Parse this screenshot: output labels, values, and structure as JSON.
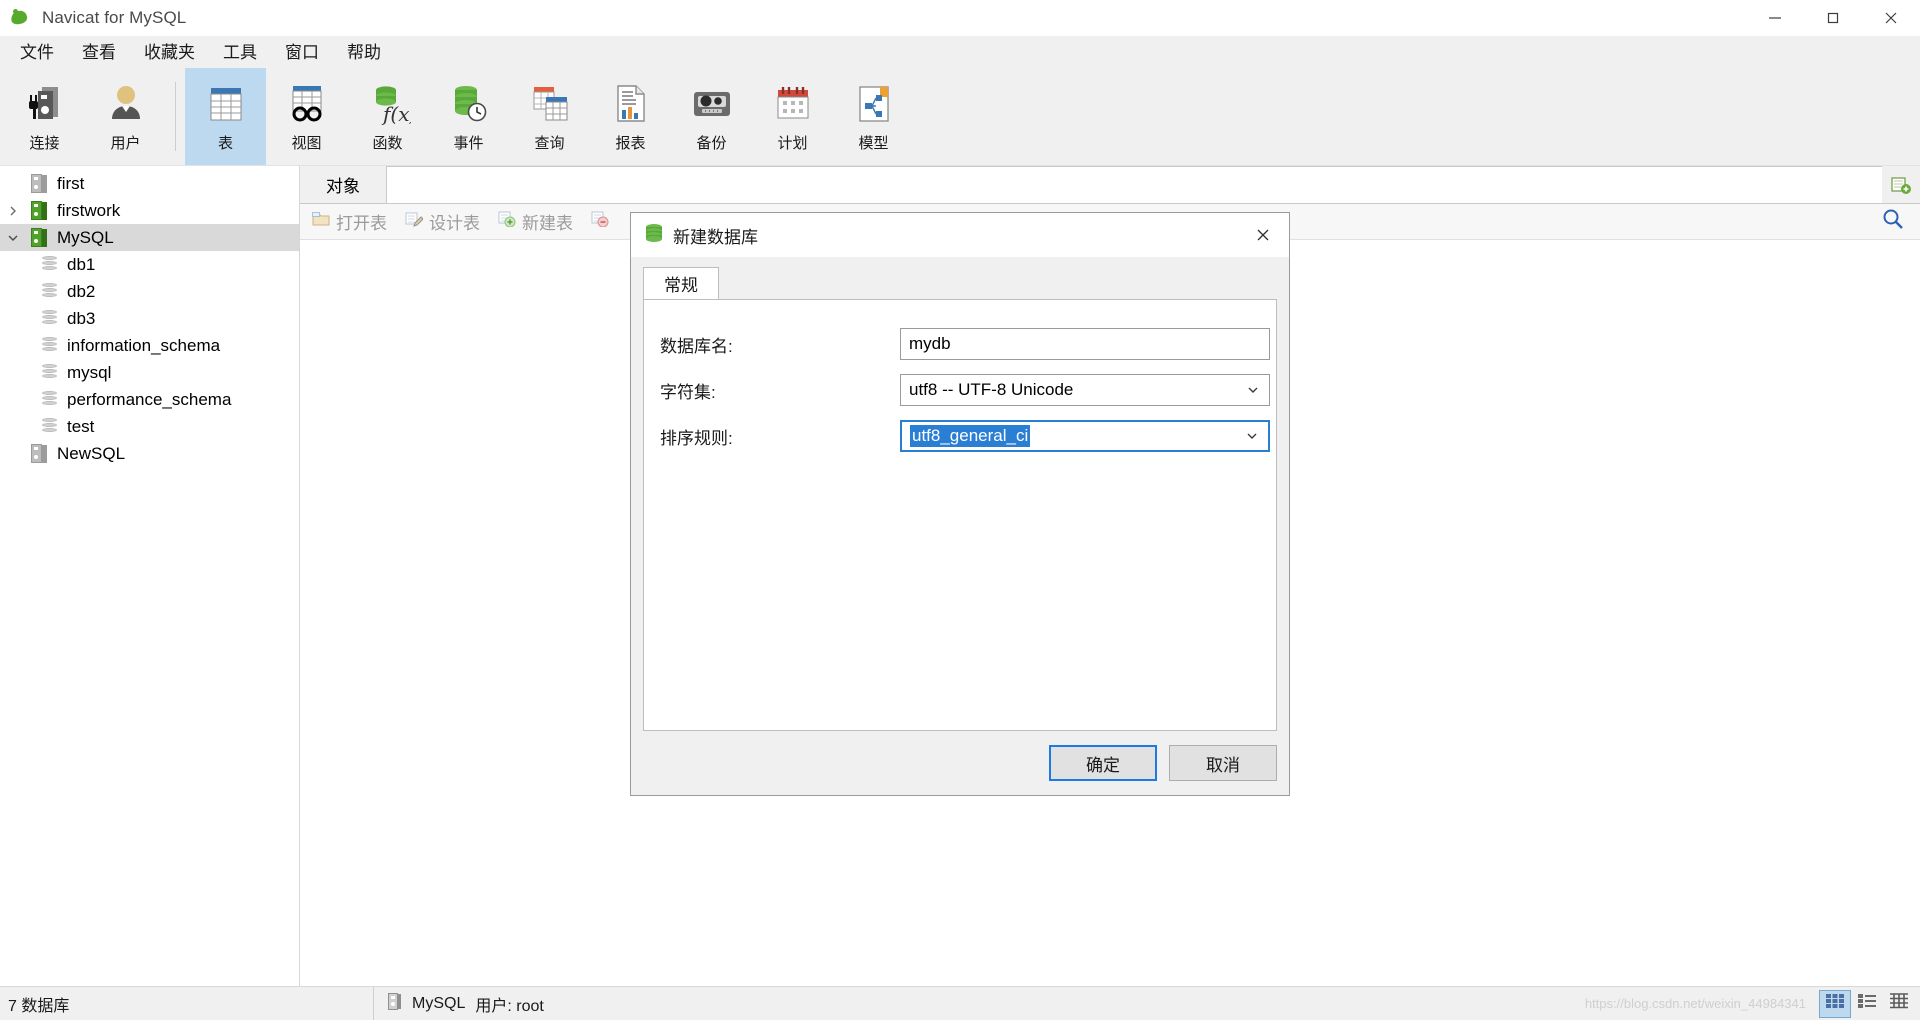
{
  "window": {
    "app_title": "Navicat for MySQL",
    "app_icon": "navicat-leaf-icon",
    "minimize": "minimize-icon",
    "maximize": "maximize-icon",
    "close": "close-icon"
  },
  "menubar": {
    "items": [
      {
        "label": "文件",
        "name": "menu-file"
      },
      {
        "label": "查看",
        "name": "menu-view"
      },
      {
        "label": "收藏夹",
        "name": "menu-favorites"
      },
      {
        "label": "工具",
        "name": "menu-tools"
      },
      {
        "label": "窗口",
        "name": "menu-window"
      },
      {
        "label": "帮助",
        "name": "menu-help"
      }
    ]
  },
  "toolbar": {
    "items": [
      {
        "label": "连接",
        "icon": "connection-icon",
        "active": false
      },
      {
        "label": "用户",
        "icon": "user-icon",
        "active": false
      },
      {
        "label": "表",
        "icon": "table-icon",
        "active": true
      },
      {
        "label": "视图",
        "icon": "view-glasses-icon",
        "active": false
      },
      {
        "label": "函数",
        "icon": "function-icon",
        "active": false
      },
      {
        "label": "事件",
        "icon": "event-clock-icon",
        "active": false
      },
      {
        "label": "查询",
        "icon": "query-icon",
        "active": false
      },
      {
        "label": "报表",
        "icon": "report-icon",
        "active": false
      },
      {
        "label": "备份",
        "icon": "backup-tape-icon",
        "active": false
      },
      {
        "label": "计划",
        "icon": "schedule-calendar-icon",
        "active": false
      },
      {
        "label": "模型",
        "icon": "model-icon",
        "active": false
      }
    ]
  },
  "sidebar": {
    "tree": [
      {
        "label": "first",
        "level": 1,
        "icon": "server-icon-gray",
        "expander": "none",
        "selected": false
      },
      {
        "label": "firstwork",
        "level": 1,
        "icon": "server-icon-green",
        "expander": "collapsed",
        "selected": false
      },
      {
        "label": "MySQL",
        "level": 1,
        "icon": "server-icon-green",
        "expander": "expanded",
        "selected": true
      },
      {
        "label": "db1",
        "level": 2,
        "icon": "database-icon",
        "expander": "none",
        "selected": false
      },
      {
        "label": "db2",
        "level": 2,
        "icon": "database-icon",
        "expander": "none",
        "selected": false
      },
      {
        "label": "db3",
        "level": 2,
        "icon": "database-icon",
        "expander": "none",
        "selected": false
      },
      {
        "label": "information_schema",
        "level": 2,
        "icon": "database-icon",
        "expander": "none",
        "selected": false
      },
      {
        "label": "mysql",
        "level": 2,
        "icon": "database-icon",
        "expander": "none",
        "selected": false
      },
      {
        "label": "performance_schema",
        "level": 2,
        "icon": "database-icon",
        "expander": "none",
        "selected": false
      },
      {
        "label": "test",
        "level": 2,
        "icon": "database-icon",
        "expander": "none",
        "selected": false
      },
      {
        "label": "NewSQL",
        "level": 1,
        "icon": "server-icon-gray",
        "expander": "none",
        "selected": false
      }
    ]
  },
  "content": {
    "tab_label": "对象",
    "add_tab_icon": "add-tab-icon",
    "search_icon": "search-icon",
    "object_buttons": [
      {
        "label": "打开表",
        "icon": "open-table-icon"
      },
      {
        "label": "设计表",
        "icon": "design-table-icon"
      },
      {
        "label": "新建表",
        "icon": "new-table-icon"
      },
      {
        "label": "",
        "icon": "delete-table-icon"
      }
    ]
  },
  "dialog": {
    "title": "新建数据库",
    "title_icon": "database-icon",
    "close_icon": "close-icon",
    "tabs": [
      {
        "label": "常规",
        "active": true
      }
    ],
    "fields": [
      {
        "name": "database-name",
        "label": "数据库名:",
        "type": "text",
        "value": "mydb",
        "highlighted": false
      },
      {
        "name": "charset",
        "label": "字符集:",
        "type": "select",
        "value": "utf8 -- UTF-8 Unicode",
        "highlighted": false
      },
      {
        "name": "collation",
        "label": "排序规则:",
        "type": "select",
        "value": "utf8_general_ci",
        "highlighted": true
      }
    ],
    "buttons": [
      {
        "label": "确定",
        "name": "ok-button",
        "primary": true
      },
      {
        "label": "取消",
        "name": "cancel-button",
        "primary": false
      }
    ]
  },
  "statusbar": {
    "left_text": "7 数据库",
    "connection_icon": "server-icon-gray",
    "connection_name": "MySQL",
    "user_text": "用户: root",
    "watermark": "https://blog.csdn.net/weixin_44984341",
    "view_buttons": [
      {
        "name": "grid-view-button",
        "icon": "grid-view-icon",
        "selected": true
      },
      {
        "name": "detail-view-button",
        "icon": "detail-view-icon",
        "selected": false
      },
      {
        "name": "list-view-button",
        "icon": "list-view-icon",
        "selected": false
      }
    ]
  },
  "colors": {
    "accent": "#2a7fd4",
    "toolbar_active": "#bcd9f0",
    "tree_selected": "#d9d9d9",
    "chrome": "#f0f0f0"
  }
}
